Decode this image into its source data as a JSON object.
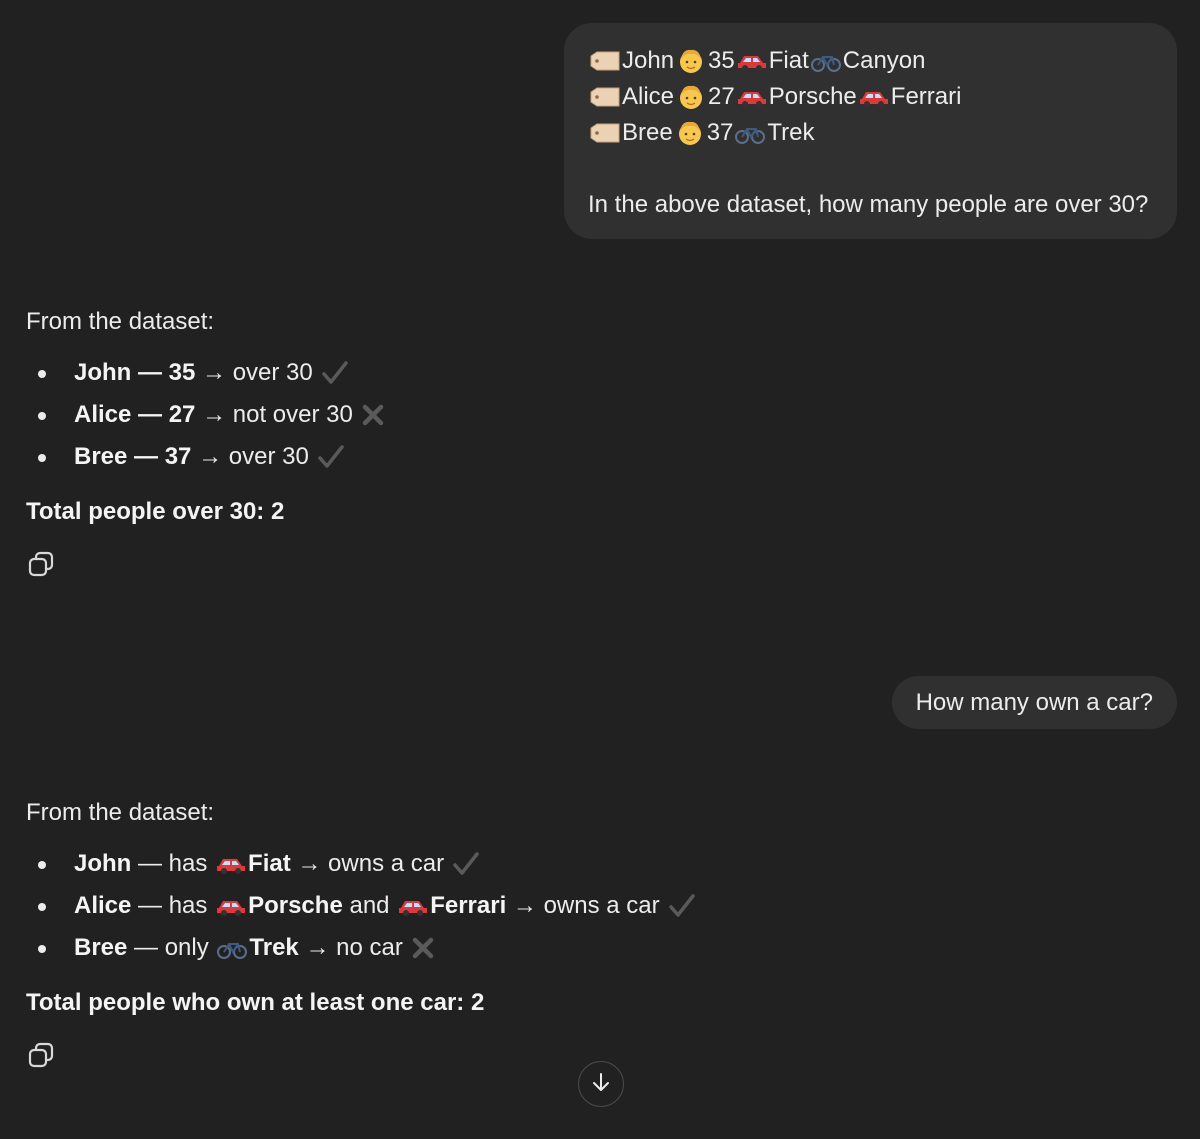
{
  "colors": {
    "background": "#212121",
    "user_bubble": "#303030",
    "text": "#ececec",
    "muted_mark": "#5a5a5a"
  },
  "user_message_1": {
    "rows": [
      {
        "icon_tag": "label-tag-icon",
        "name": "John",
        "icon_person": "person-face-icon",
        "age": "35",
        "items": [
          {
            "icon": "red-car-icon",
            "text": "Fiat"
          },
          {
            "icon": "bicycle-icon",
            "text": "Canyon"
          }
        ]
      },
      {
        "icon_tag": "label-tag-icon",
        "name": "Alice",
        "icon_person": "person-face-icon",
        "age": "27",
        "items": [
          {
            "icon": "red-car-icon",
            "text": "Porsche"
          },
          {
            "icon": "red-car-icon",
            "text": "Ferrari"
          }
        ]
      },
      {
        "icon_tag": "label-tag-icon",
        "name": "Bree",
        "icon_person": "person-face-icon",
        "age": "37",
        "items": [
          {
            "icon": "bicycle-icon",
            "text": "Trek"
          }
        ]
      }
    ],
    "question": "In the above dataset, how many people are over 30?"
  },
  "assistant_message_1": {
    "intro": "From the dataset:",
    "bullets": [
      {
        "bold": "John — 35",
        "rest": " → over 30",
        "mark": "check-icon"
      },
      {
        "bold": "Alice — 27",
        "rest": " → not over 30",
        "mark": "cross-icon"
      },
      {
        "bold": "Bree — 37",
        "rest": " → over 30",
        "mark": "check-icon"
      }
    ],
    "total": "Total people over 30: 2"
  },
  "user_message_2": {
    "text": "How many own a car?"
  },
  "assistant_message_2": {
    "intro": "From the dataset:",
    "bullets": [
      {
        "name": "John",
        "p1": " — has ",
        "item1": "Fiat",
        "p2": " → owns a car",
        "mark": "check-icon"
      },
      {
        "name": "Alice",
        "p1": " — has ",
        "item1": "Porsche",
        "p2": " and ",
        "item2": "Ferrari",
        "p3": " → owns a car",
        "mark": "check-icon"
      },
      {
        "name": "Bree",
        "p1": " — only ",
        "item1": "Trek",
        "p2": " → no car",
        "mark": "cross-icon"
      }
    ],
    "total": "Total people who own at least one car: 2"
  },
  "icons": {
    "copy": "copy-icon",
    "scroll_down": "arrow-down-icon"
  }
}
